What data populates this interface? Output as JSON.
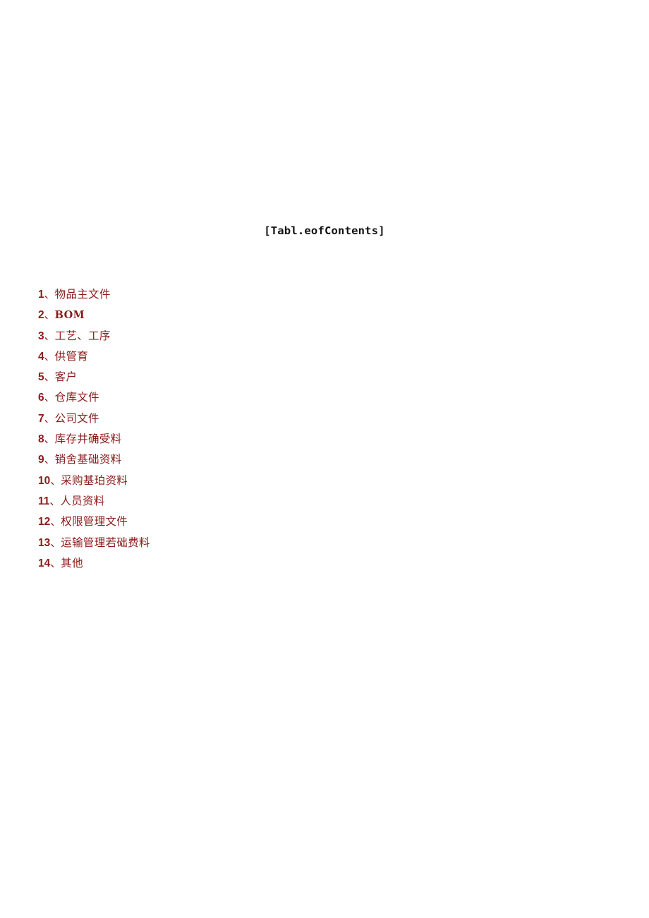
{
  "document": {
    "title": "[Tabl.eofContents]",
    "text_color": "#8B1A1A",
    "title_color": "#111111",
    "background_color": "#ffffff",
    "separator": "、"
  },
  "toc": {
    "items": [
      {
        "number": "1",
        "label": "物品主文件",
        "style": "cjk"
      },
      {
        "number": "2",
        "label": "BOM",
        "style": "latin-bold"
      },
      {
        "number": "3",
        "label": "工艺、工序",
        "style": "cjk"
      },
      {
        "number": "4",
        "label": "供管育",
        "style": "cjk"
      },
      {
        "number": "5",
        "label": "客户",
        "style": "cjk"
      },
      {
        "number": "6",
        "label": "仓库文件",
        "style": "cjk"
      },
      {
        "number": "7",
        "label": "公司文件",
        "style": "cjk"
      },
      {
        "number": "8",
        "label": "库存井确受料",
        "style": "cjk"
      },
      {
        "number": "9",
        "label": "销舍基础资料",
        "style": "cjk"
      },
      {
        "number": "10",
        "label": "采购基珀资料",
        "style": "cjk"
      },
      {
        "number": "11",
        "label": "人员资料",
        "style": "cjk"
      },
      {
        "number": "12",
        "label": "权限管理文件",
        "style": "cjk"
      },
      {
        "number": "13",
        "label": "运输管理若础费料",
        "style": "cjk"
      },
      {
        "number": "14",
        "label": "其他",
        "style": "cjk"
      }
    ]
  }
}
